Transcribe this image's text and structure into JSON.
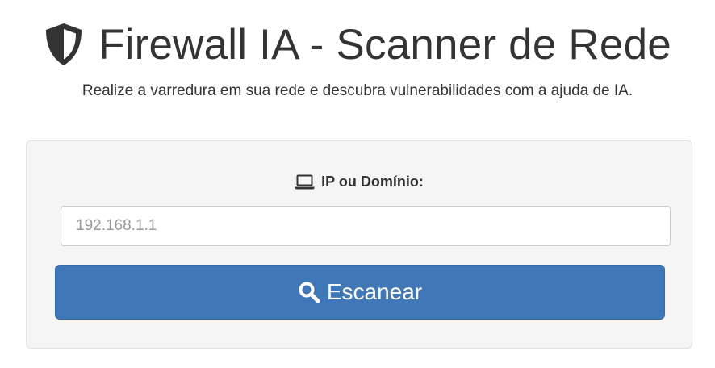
{
  "header": {
    "icon": "shield-icon",
    "title": "Firewall IA - Scanner de Rede",
    "subtitle": "Realize a varredura em sua rede e descubra vulnerabilidades com a ajuda de IA."
  },
  "form": {
    "label_icon": "laptop-icon",
    "label": "IP ou Domínio:",
    "input": {
      "value": "",
      "placeholder": "192.168.1.1"
    },
    "button": {
      "icon": "search-icon",
      "label": "Escanear"
    }
  },
  "colors": {
    "text": "#333333",
    "card_background": "#f5f5f5",
    "button_primary": "#3f77b7",
    "input_border": "#cccccc"
  }
}
